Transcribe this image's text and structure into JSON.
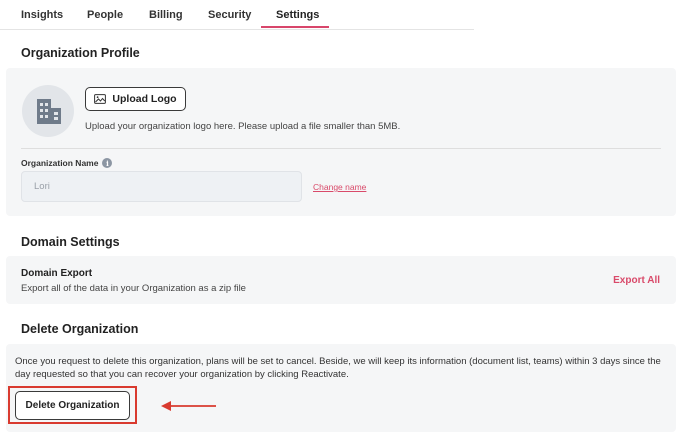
{
  "tabs": [
    {
      "label": "Insights"
    },
    {
      "label": "People"
    },
    {
      "label": "Billing"
    },
    {
      "label": "Security"
    },
    {
      "label": "Settings",
      "active": true
    }
  ],
  "org_profile": {
    "title": "Organization Profile",
    "avatar_icon": "building-icon",
    "upload_button": {
      "label": "Upload Logo",
      "icon": "image-icon"
    },
    "hint": "Upload your organization logo here. Please upload a file smaller than 5MB.",
    "name_label": "Organization Name",
    "info_icon": "info-icon",
    "name_value": "Lori",
    "change_name_link": "Change name"
  },
  "domain_settings": {
    "title": "Domain Settings",
    "heading": "Domain Export",
    "description": "Export all of the data in your Organization as a zip file",
    "export_link": "Export All"
  },
  "delete_org": {
    "title": "Delete Organization",
    "description": "Once you request to delete this organization, plans will be set to cancel. Beside, we will keep its information (document list, teams) within 3 days since the day requested so that you can recover your organization by clicking Reactivate.",
    "button_label": "Delete Organization"
  },
  "colors": {
    "accent": "#d94a6a",
    "annotation_red": "#d93a2f",
    "panel_bg": "#f5f6f7"
  }
}
